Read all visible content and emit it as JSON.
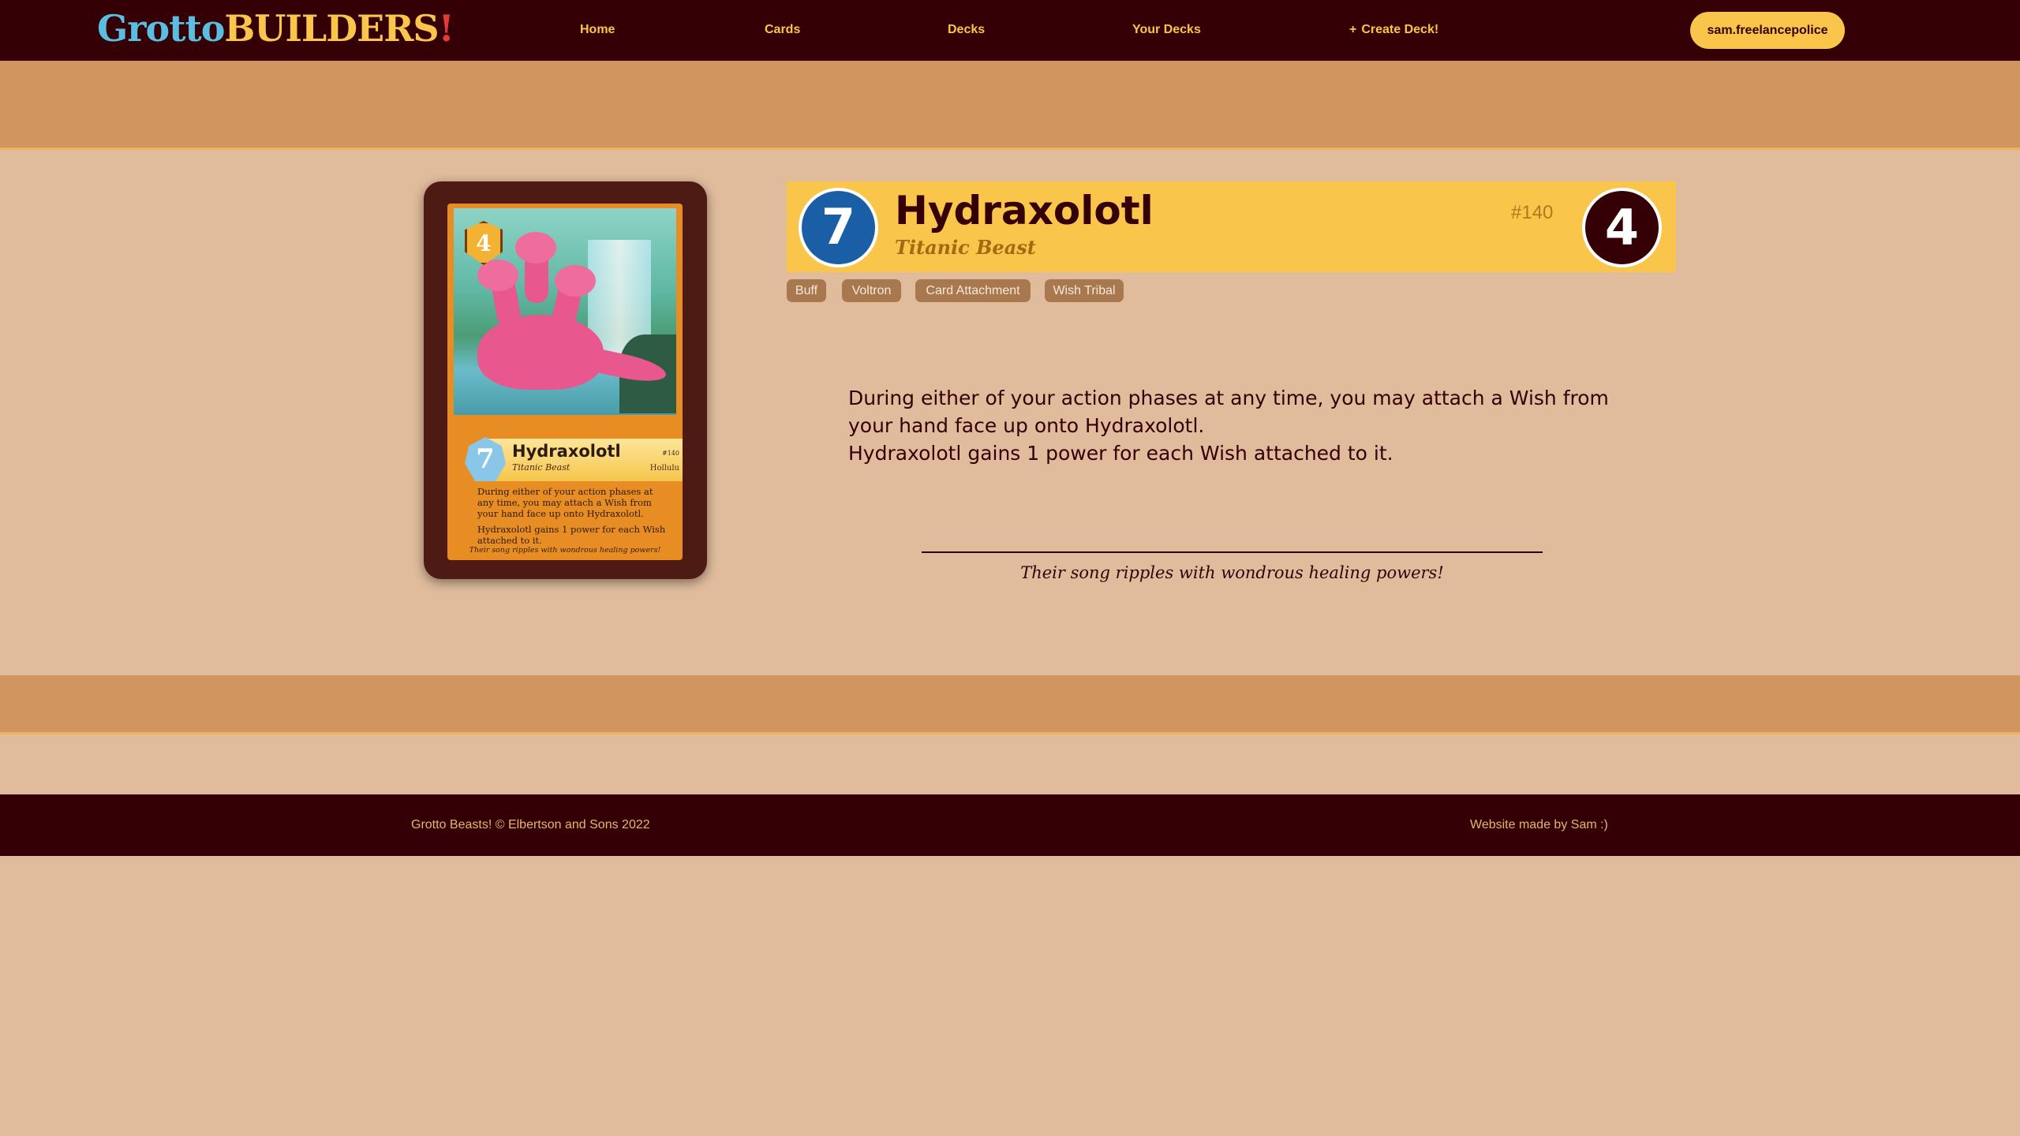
{
  "nav": {
    "logo_part1": "Grotto",
    "logo_part2": "BUILDERS",
    "logo_part3": "!",
    "links": [
      {
        "label": "Home"
      },
      {
        "label": "Cards"
      },
      {
        "label": "Decks"
      },
      {
        "label": "Your Decks"
      }
    ],
    "create_label": "Create Deck!",
    "create_icon": "+",
    "user_label": "sam.freelancepolice"
  },
  "card": {
    "name": "Hydraxolotl",
    "type": "Titanic Beast",
    "number": "#140",
    "cost": "7",
    "power": "4",
    "tags": [
      "Buff",
      "Voltron",
      "Card Attachment",
      "Wish Tribal"
    ],
    "ability_lines": [
      "During either of your action phases at any time, you may attach a Wish from your hand face up onto Hydraxolotl.",
      "Hydraxolotl gains 1 power for each Wish attached to it."
    ],
    "flavor": "Their song ripples with wondrous healing powers!"
  },
  "card_image": {
    "cost": "4",
    "power": "7",
    "title": "Hydraxolotl",
    "type": "Titanic Beast",
    "number": "#140",
    "artist": "Hollulu",
    "text_1": "During either of your action phases at any time, you may attach a Wish from your hand face up onto Hydraxolotl.",
    "text_2": "Hydraxolotl gains 1 power for each Wish attached to it.",
    "flavor": "Their song ripples with wondrous healing powers!"
  },
  "footer": {
    "left": "Grotto Beasts! © Elbertson and Sons 2022",
    "right": "Website made by Sam :)"
  },
  "colors": {
    "navbar": "#350005",
    "accent": "#f9c54a",
    "page_bg": "#e0bc9c",
    "band": "#d19660",
    "cost_circle": "#1a5fa6"
  }
}
